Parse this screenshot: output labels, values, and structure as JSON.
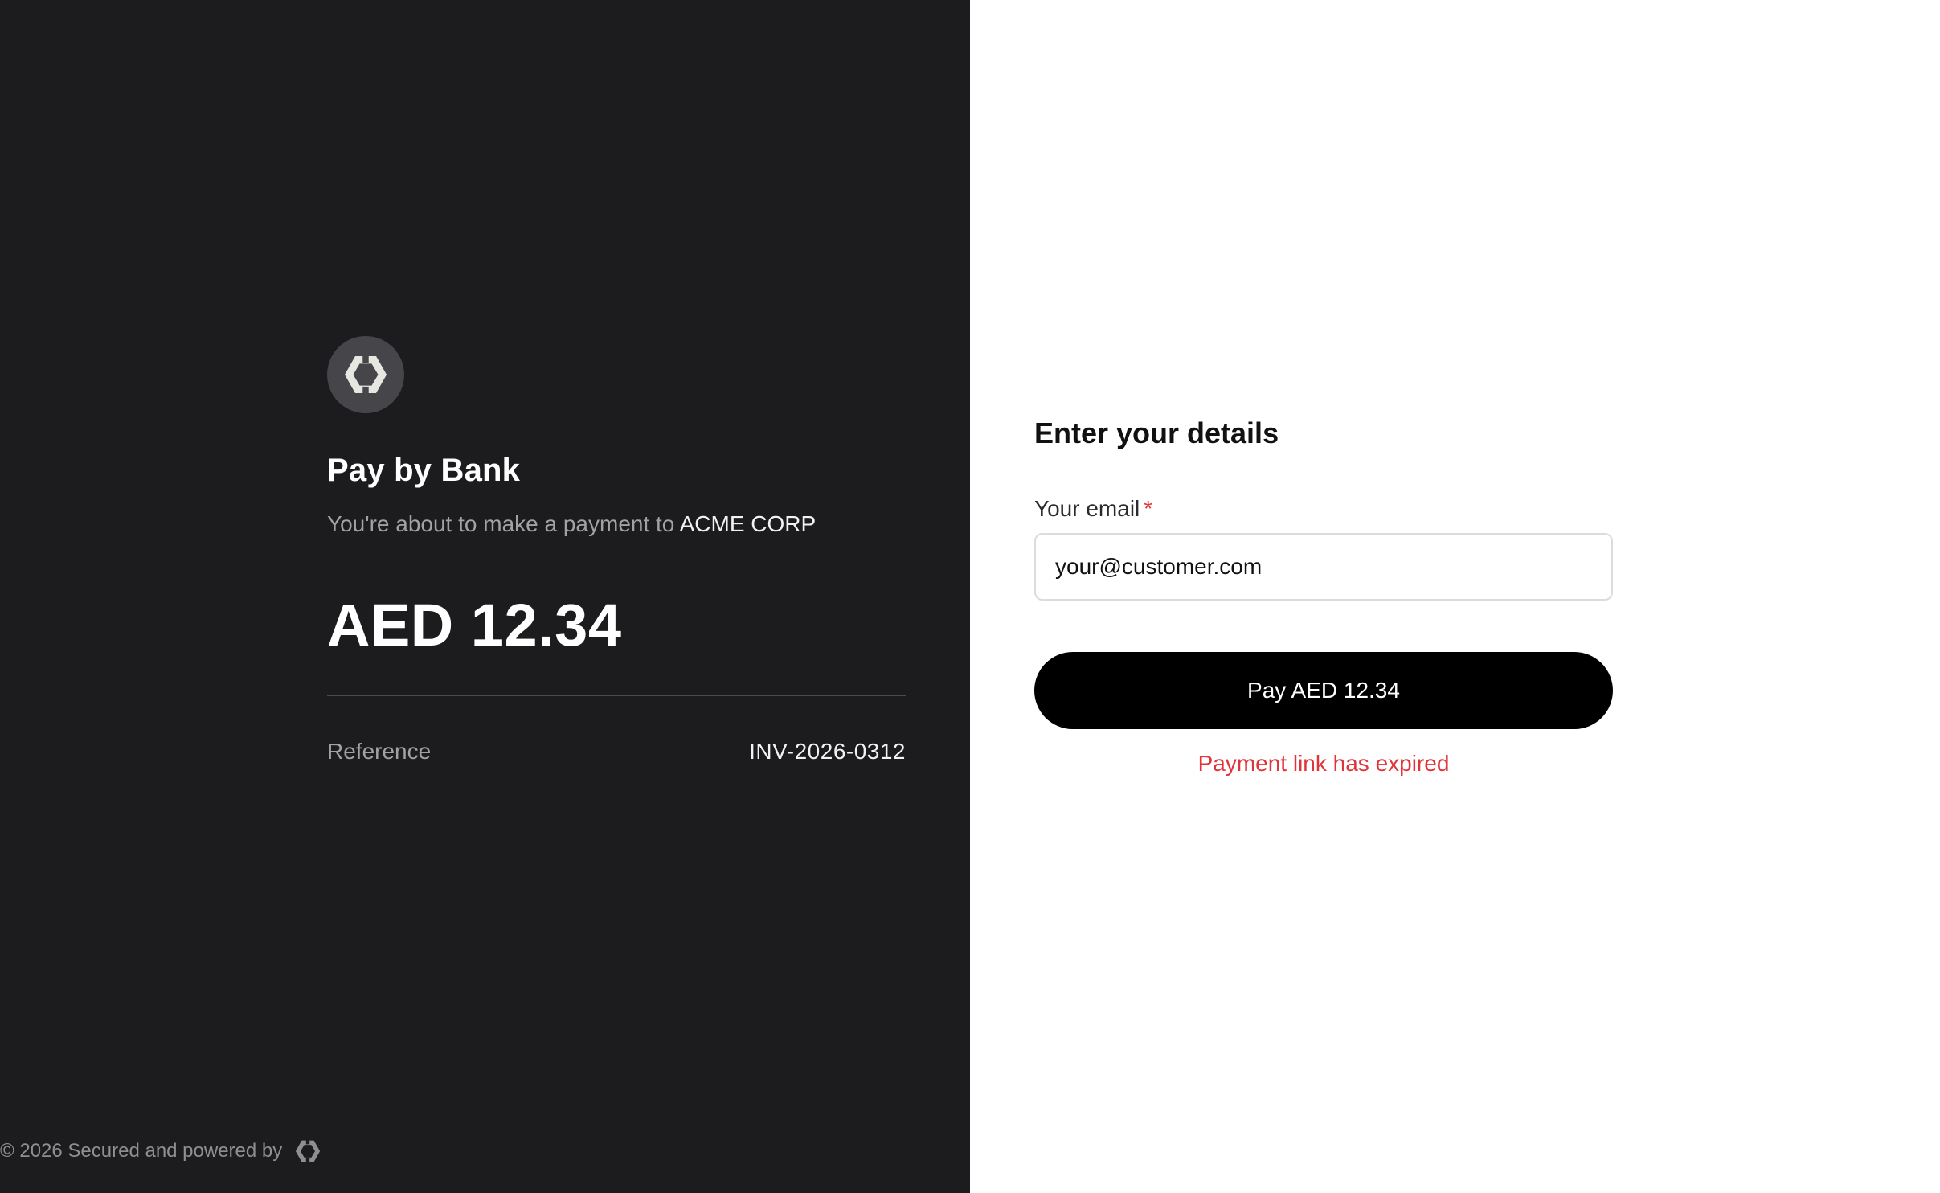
{
  "colors": {
    "left_panel_bg": "#1c1c1e",
    "right_panel_bg": "#ffffff",
    "button_bg": "#000000",
    "error": "#e0343a",
    "required_marker": "#e5393b"
  },
  "summary": {
    "logo_icon": "hexagon-logo-icon",
    "title": "Pay by Bank",
    "payee_prefix": "You're about to make a payment to ",
    "payee_name": "ACME CORP",
    "amount": "AED 12.34",
    "reference_label": "Reference",
    "reference_value": "INV-2026-0312"
  },
  "footer": {
    "text": "© 2026 Secured and powered by",
    "icon": "hexagon-logo-icon"
  },
  "form": {
    "title": "Enter your details",
    "email_label": "Your email",
    "required_marker": "*",
    "email_value": "your@customer.com",
    "submit_label": "Pay AED 12.34",
    "error_message": "Payment link has expired"
  }
}
